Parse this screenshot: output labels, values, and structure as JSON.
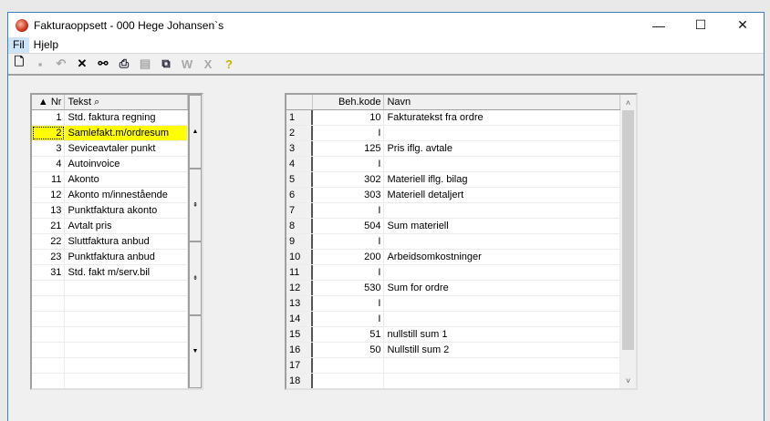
{
  "window": {
    "title": "Fakturaoppsett - 000 Hege Johansen`s",
    "minimize": "—",
    "maximize": "☐",
    "close": "✕"
  },
  "menu": [
    "Fil",
    "Hjelp"
  ],
  "toolbar": [
    {
      "icon": "new-document-icon",
      "glyph": "🗋",
      "enabled": true
    },
    {
      "icon": "save-icon",
      "glyph": "▪",
      "enabled": false
    },
    {
      "icon": "undo-icon",
      "glyph": "↶",
      "enabled": false
    },
    {
      "icon": "delete-icon",
      "glyph": "✕",
      "enabled": true
    },
    {
      "icon": "binoculars-icon",
      "glyph": "⚯",
      "enabled": true
    },
    {
      "icon": "print-icon",
      "glyph": "⎙",
      "enabled": true
    },
    {
      "icon": "form-icon",
      "glyph": "▤",
      "enabled": false
    },
    {
      "icon": "copy-icon",
      "glyph": "⧉",
      "enabled": true
    },
    {
      "icon": "word-icon",
      "glyph": "W",
      "enabled": false
    },
    {
      "icon": "excel-icon",
      "glyph": "X",
      "enabled": false
    },
    {
      "icon": "help-icon",
      "glyph": "?",
      "enabled": true
    }
  ],
  "left_grid": {
    "headers": {
      "nr": "▲ Nr",
      "tekst": "Tekst ⌕"
    },
    "rows": [
      {
        "nr": "1",
        "tekst": "Std. faktura regning"
      },
      {
        "nr": "2",
        "tekst": "Samlefakt.m/ordresum",
        "selected": true
      },
      {
        "nr": "3",
        "tekst": "Seviceavtaler punkt"
      },
      {
        "nr": "4",
        "tekst": "Autoinvoice"
      },
      {
        "nr": "11",
        "tekst": "Akonto"
      },
      {
        "nr": "12",
        "tekst": "Akonto m/innestående"
      },
      {
        "nr": "13",
        "tekst": "Punktfaktura akonto"
      },
      {
        "nr": "21",
        "tekst": "Avtalt pris"
      },
      {
        "nr": "22",
        "tekst": "Sluttfaktura anbud"
      },
      {
        "nr": "23",
        "tekst": "Punktfaktura anbud"
      },
      {
        "nr": "31",
        "tekst": "Std. fakt m/serv.bil"
      },
      {
        "nr": "",
        "tekst": ""
      },
      {
        "nr": "",
        "tekst": ""
      },
      {
        "nr": "",
        "tekst": ""
      },
      {
        "nr": "",
        "tekst": ""
      },
      {
        "nr": "",
        "tekst": ""
      },
      {
        "nr": "",
        "tekst": ""
      },
      {
        "nr": "",
        "tekst": ""
      }
    ],
    "scroll_buttons": [
      "▲",
      "⇞",
      "⇟",
      "▼"
    ]
  },
  "right_grid": {
    "headers": {
      "row": "",
      "kode": "Beh.kode",
      "navn": "Navn"
    },
    "rows": [
      {
        "n": "1",
        "kode": "10",
        "navn": "Fakturatekst fra ordre"
      },
      {
        "n": "2",
        "kode": "I",
        "navn": ""
      },
      {
        "n": "3",
        "kode": "125",
        "navn": "Pris iflg. avtale"
      },
      {
        "n": "4",
        "kode": "I",
        "navn": ""
      },
      {
        "n": "5",
        "kode": "302",
        "navn": "Materiell iflg. bilag"
      },
      {
        "n": "6",
        "kode": "303",
        "navn": "Materiell detaljert"
      },
      {
        "n": "7",
        "kode": "I",
        "navn": ""
      },
      {
        "n": "8",
        "kode": "504",
        "navn": "Sum materiell"
      },
      {
        "n": "9",
        "kode": "I",
        "navn": ""
      },
      {
        "n": "10",
        "kode": "200",
        "navn": "Arbeidsomkostninger"
      },
      {
        "n": "11",
        "kode": "I",
        "navn": ""
      },
      {
        "n": "12",
        "kode": "530",
        "navn": "Sum for ordre"
      },
      {
        "n": "13",
        "kode": "I",
        "navn": ""
      },
      {
        "n": "14",
        "kode": "I",
        "navn": ""
      },
      {
        "n": "15",
        "kode": "51",
        "navn": "nullstill sum 1"
      },
      {
        "n": "16",
        "kode": "50",
        "navn": "Nullstill sum 2"
      },
      {
        "n": "17",
        "kode": "",
        "navn": ""
      },
      {
        "n": "18",
        "kode": "",
        "navn": ""
      }
    ],
    "scroll_up": "˄",
    "scroll_down": "˅"
  }
}
